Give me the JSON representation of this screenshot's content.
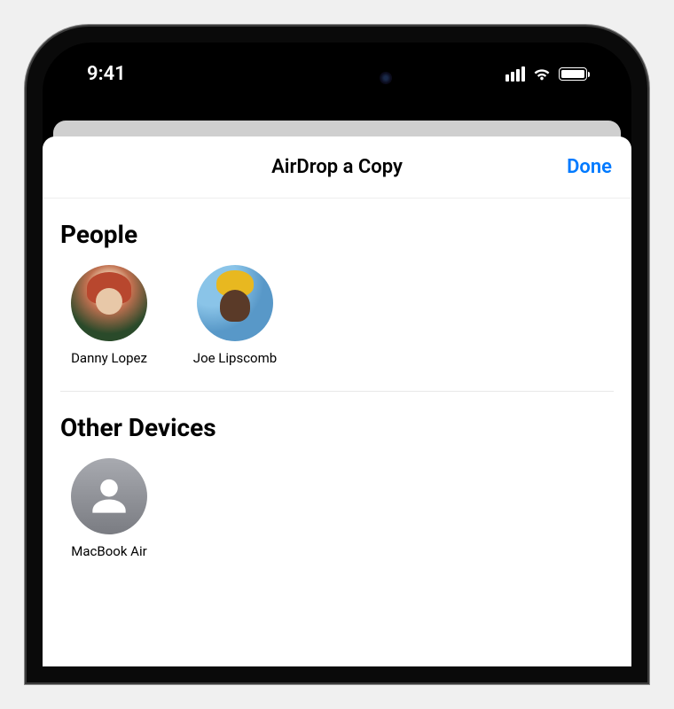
{
  "status": {
    "time": "9:41"
  },
  "sheet": {
    "title": "AirDrop a Copy",
    "done_label": "Done"
  },
  "sections": {
    "people": {
      "title": "People",
      "items": [
        {
          "name": "Danny Lopez"
        },
        {
          "name": "Joe Lipscomb"
        }
      ]
    },
    "devices": {
      "title": "Other Devices",
      "items": [
        {
          "name": "MacBook Air"
        }
      ]
    }
  }
}
